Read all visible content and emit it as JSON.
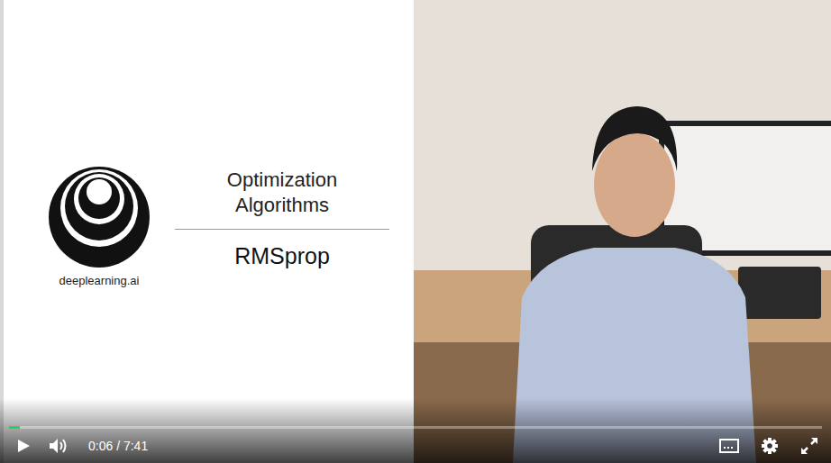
{
  "slide": {
    "logo_caption": "deeplearning.ai",
    "title_lines": [
      "Optimization",
      "Algorithms"
    ],
    "subtitle": "RMSprop"
  },
  "player": {
    "playing": false,
    "current": "0:06",
    "separator": "/",
    "duration": "7:41",
    "progress": {
      "level": 0.013
    },
    "captions_on": false
  }
}
